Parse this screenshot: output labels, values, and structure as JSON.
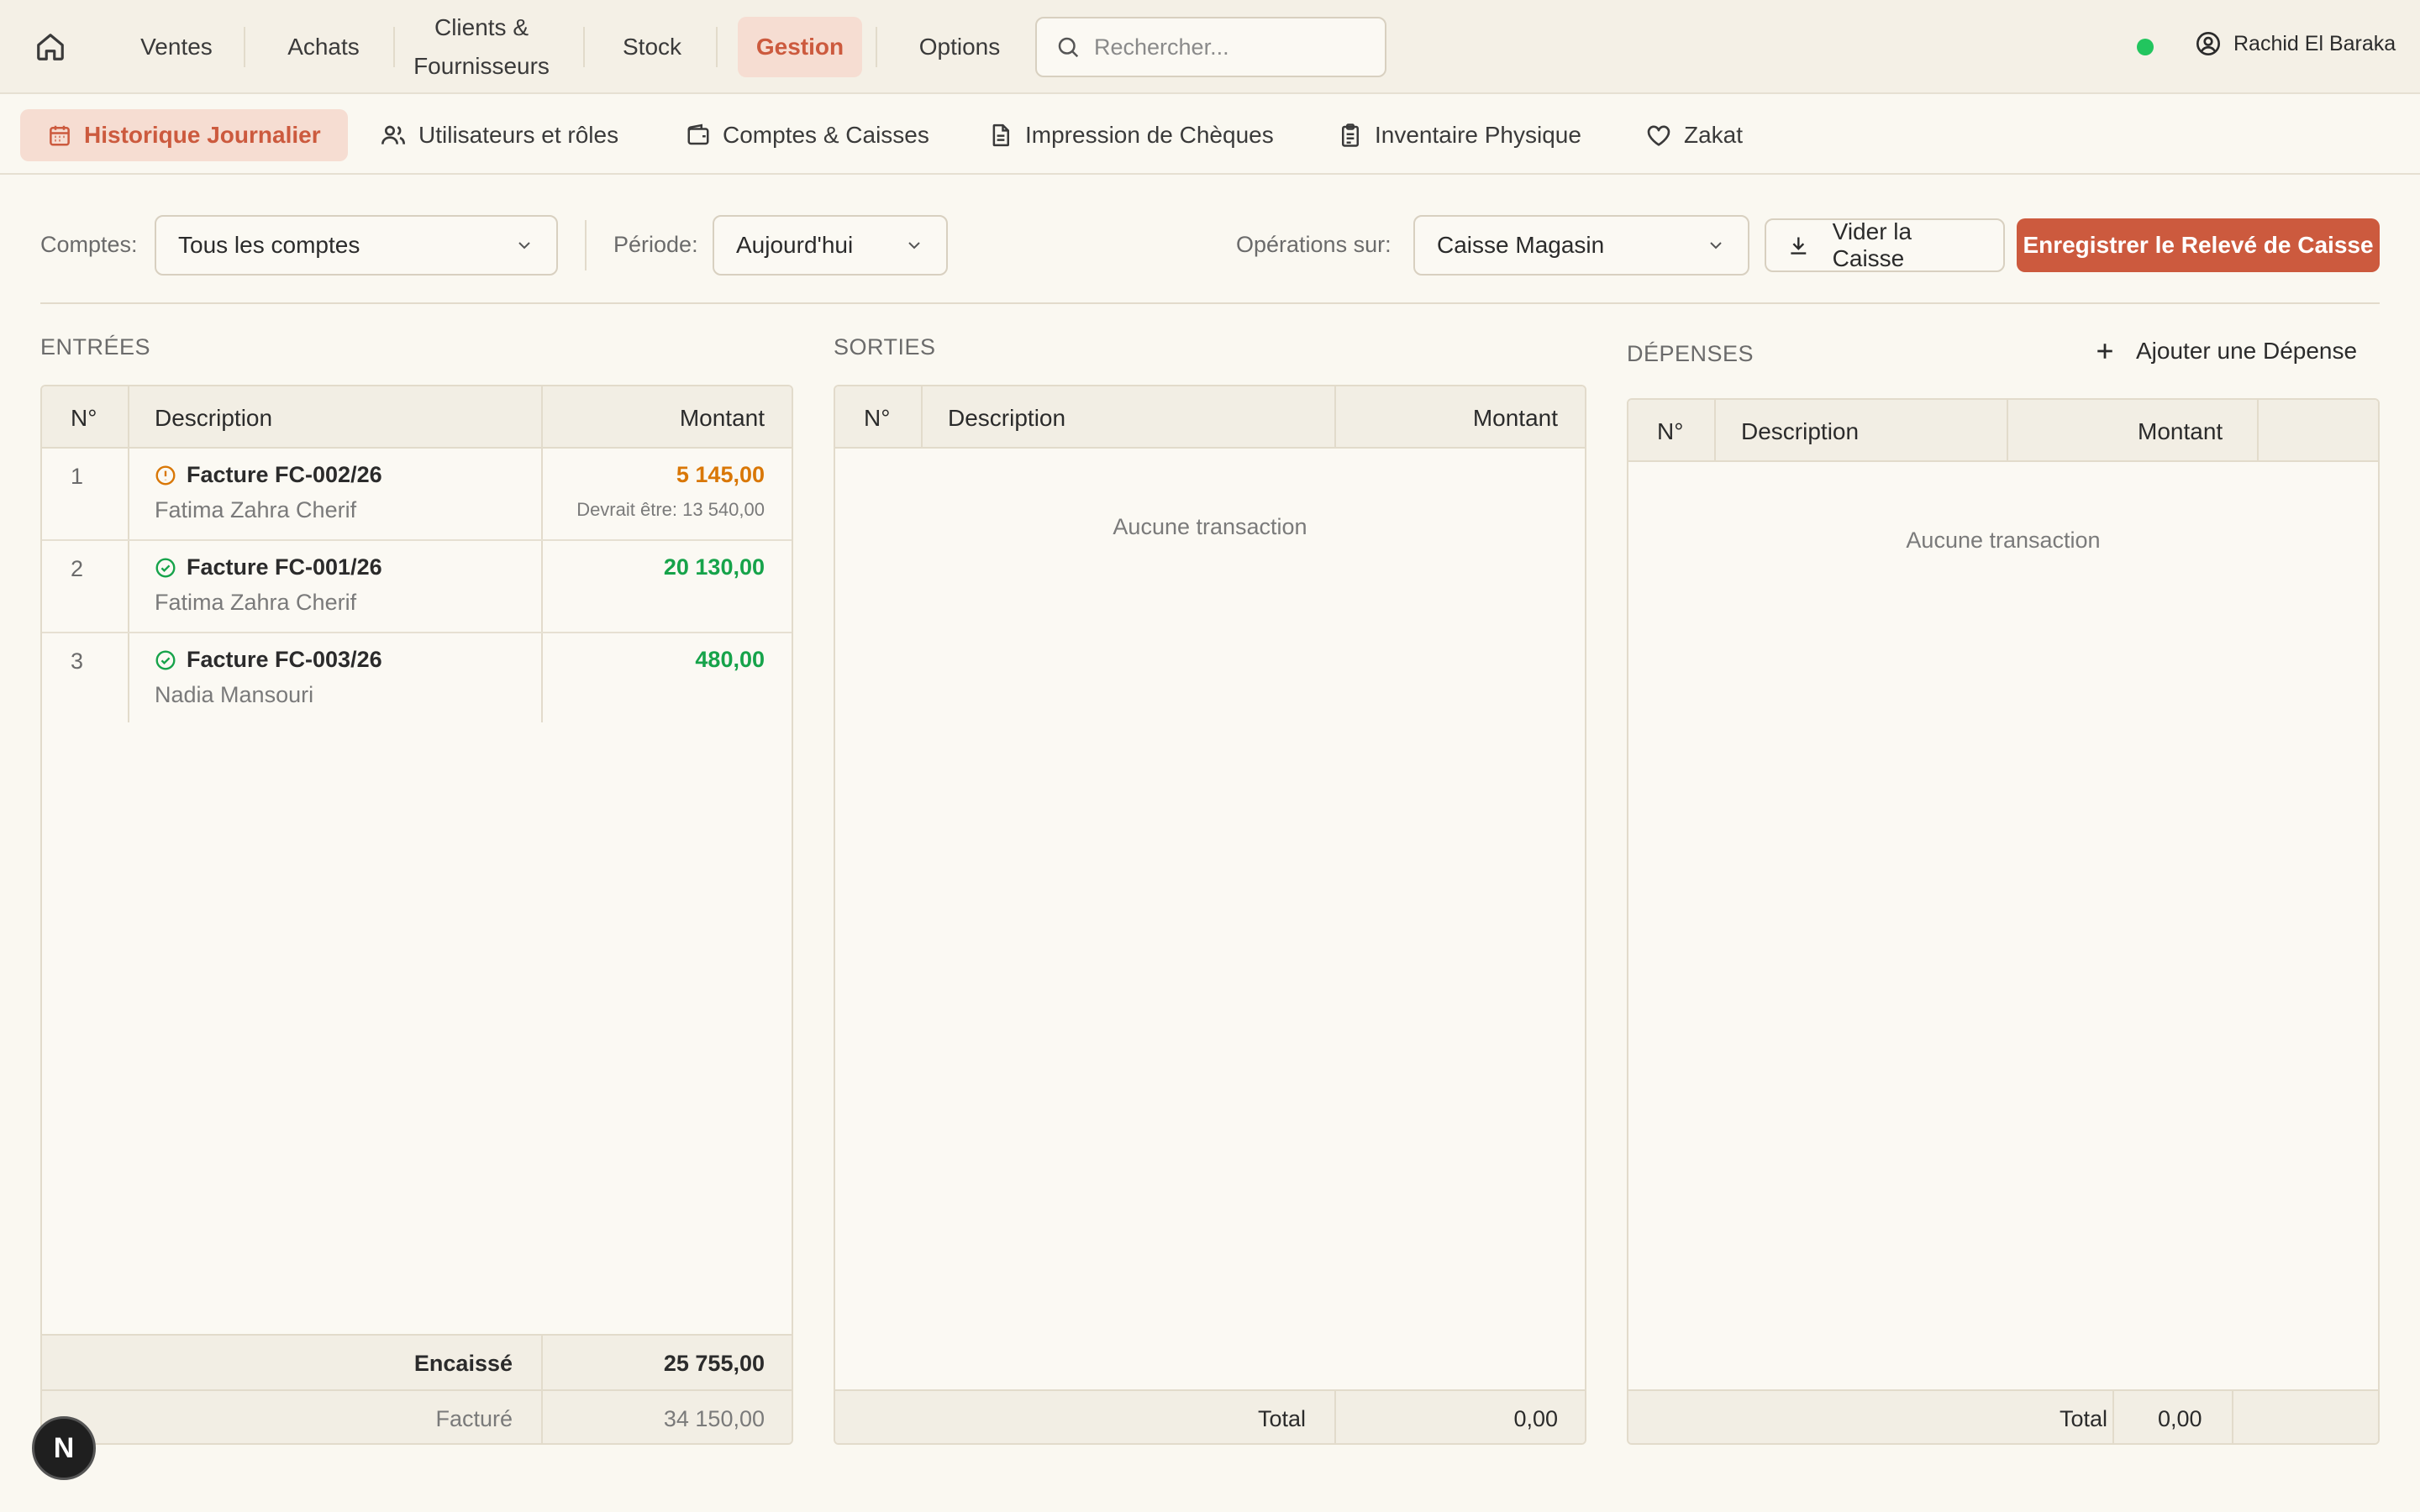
{
  "topnav": {
    "items": [
      {
        "label": "Ventes"
      },
      {
        "label": "Achats"
      },
      {
        "label": "Clients &"
      },
      {
        "label": "Stock"
      },
      {
        "label": "Gestion"
      },
      {
        "label": "Options"
      }
    ],
    "clients_line2": "Fournisseurs",
    "search_placeholder": "Rechercher...",
    "user_name": "Rachid El Baraka",
    "status_color": "#22C55E"
  },
  "subnav": {
    "tabs": [
      {
        "label": "Historique Journalier",
        "icon": "calendar-icon"
      },
      {
        "label": "Utilisateurs et rôles",
        "icon": "users-icon"
      },
      {
        "label": "Comptes & Caisses",
        "icon": "wallet-icon"
      },
      {
        "label": "Impression de Chèques",
        "icon": "document-icon"
      },
      {
        "label": "Inventaire Physique",
        "icon": "clipboard-icon"
      },
      {
        "label": "Zakat",
        "icon": "heart-icon"
      }
    ]
  },
  "filters": {
    "accounts_label": "Comptes:",
    "accounts_value": "Tous les comptes",
    "period_label": "Période:",
    "period_value": "Aujourd'hui",
    "operations_label": "Opérations sur:",
    "operations_value": "Caisse Magasin",
    "empty_register_label": "Vider la Caisse",
    "save_statement_label": "Enregistrer le Relevé de Caisse"
  },
  "entries": {
    "title": "ENTRÉES",
    "headers": {
      "n": "N°",
      "description": "Description",
      "amount": "Montant"
    },
    "rows": [
      {
        "n": "1",
        "title": "Facture FC-002/26",
        "client": "Fatima Zahra Cherif",
        "amount": "5 145,00",
        "note": "Devrait être: 13 540,00",
        "status": "warning",
        "color": "#D97706"
      },
      {
        "n": "2",
        "title": "Facture FC-001/26",
        "client": "Fatima Zahra Cherif",
        "amount": "20 130,00",
        "note": "",
        "status": "ok",
        "color": "#16A34A"
      },
      {
        "n": "3",
        "title": "Facture FC-003/26",
        "client": "Nadia Mansouri",
        "amount": "480,00",
        "note": "",
        "status": "ok",
        "color": "#16A34A"
      }
    ],
    "footer": {
      "collected_label": "Encaissé",
      "collected_value": "25 755,00",
      "invoiced_label": "Facturé",
      "invoiced_value": "34 150,00"
    }
  },
  "outputs": {
    "title": "SORTIES",
    "headers": {
      "n": "N°",
      "description": "Description",
      "amount": "Montant"
    },
    "empty": "Aucune transaction",
    "total_label": "Total",
    "total_value": "0,00"
  },
  "expenses": {
    "title": "DÉPENSES",
    "add_label": "Ajouter une Dépense",
    "headers": {
      "n": "N°",
      "description": "Description",
      "amount": "Montant"
    },
    "empty": "Aucune transaction",
    "total_label": "Total",
    "total_value": "0,00"
  },
  "fab_label": "N"
}
